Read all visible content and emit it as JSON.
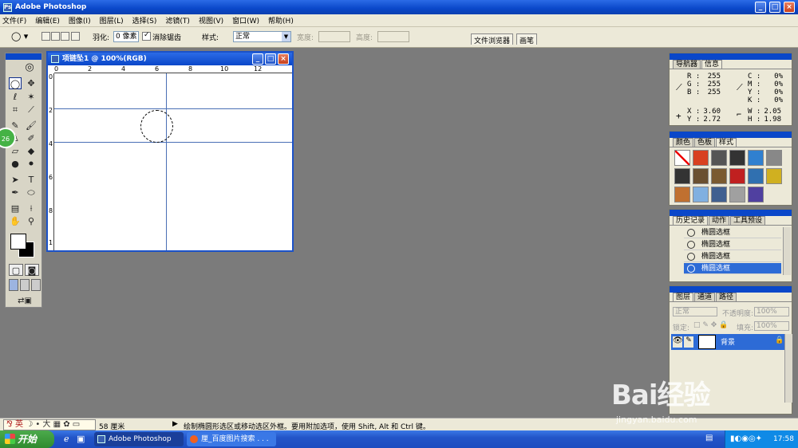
{
  "window": {
    "title": "Adobe Photoshop",
    "controls": [
      "_",
      "□",
      "×"
    ]
  },
  "menu": [
    "文件(F)",
    "编辑(E)",
    "图像(I)",
    "图层(L)",
    "选择(S)",
    "滤镜(T)",
    "视图(V)",
    "窗口(W)",
    "帮助(H)"
  ],
  "options": {
    "feather_label": "羽化:",
    "feather_value": "0 像素",
    "antialias_label": "消除锯齿",
    "style_label": "样式:",
    "style_value": "正常",
    "width_label": "宽度:",
    "height_label": "高度:",
    "file_browser_tab": "文件浏览器",
    "brushes_tab": "画笔"
  },
  "document": {
    "title": "项链坠1 @ 100%(RGB)",
    "h_ruler_labels": [
      "0",
      "2",
      "4",
      "6",
      "8",
      "10",
      "12"
    ],
    "v_ruler_labels": [
      "0",
      "2",
      "4",
      "6",
      "8",
      "1"
    ]
  },
  "tool_badge": "26",
  "info_panel": {
    "tabs": [
      "导航器",
      "信息"
    ],
    "rgb": {
      "R": "255",
      "G": "255",
      "B": "255"
    },
    "cmyk": {
      "C": "0%",
      "M": "0%",
      "Y": "0%",
      "K": "0%"
    },
    "xy": {
      "X": "3.60",
      "Y": "2.72"
    },
    "wh": {
      "W": "2.05",
      "H": "1.98"
    }
  },
  "styles_panel": {
    "tabs": [
      "颜色",
      "色板",
      "样式"
    ],
    "swatch_colors": [
      "#ffffff",
      "#d84020",
      "#555555",
      "#333333",
      "#3080d0",
      "#888888",
      "#333333",
      "#6a5030",
      "#7a5a30",
      "#c02020",
      "#3070b0",
      "#d0b020",
      "#c07030",
      "#80b0e0",
      "#406090",
      "#a0a0a0",
      "#5040a0"
    ]
  },
  "history_panel": {
    "tabs": [
      "历史记录",
      "动作",
      "工具预设"
    ],
    "items": [
      "椭圆选框",
      "椭圆选框",
      "椭圆选框",
      "椭圆选框"
    ]
  },
  "layers_panel": {
    "tabs": [
      "图层",
      "通道",
      "路径"
    ],
    "blend_mode": "正常",
    "opacity_label": "不透明度:",
    "opacity_value": "100%",
    "lock_label": "锁定:",
    "fill_label": "填充:",
    "fill_value": "100%",
    "layer_name": "背景"
  },
  "status": {
    "ime_text": "英",
    "size": "58 厘米",
    "hint": "绘制椭圆形选区或移动选区外框。要用附加选项，使用 Shift, Alt 和 Ctrl 键。"
  },
  "taskbar": {
    "start": "开始",
    "tasks": [
      "Adobe Photoshop",
      "厘_百度图片搜索 . . ."
    ],
    "clock": "17:58"
  },
  "watermark": {
    "text": "Bai经验",
    "url": "jingyan.baidu.com"
  }
}
